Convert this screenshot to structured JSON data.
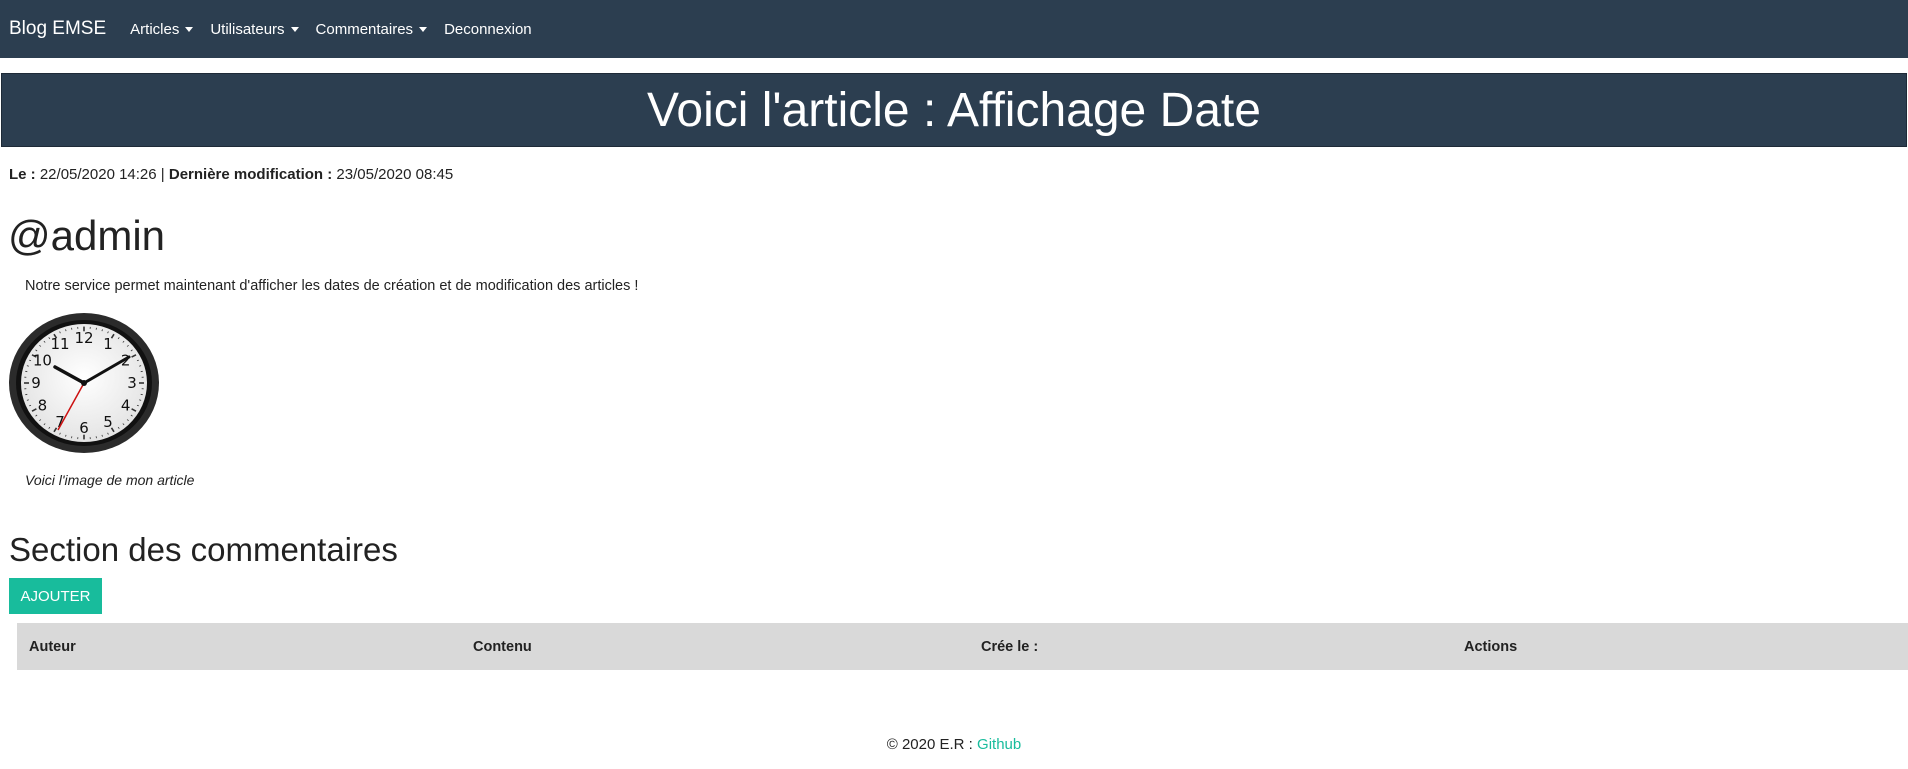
{
  "navbar": {
    "brand": "Blog EMSE",
    "items": [
      {
        "label": "Articles",
        "dropdown": true
      },
      {
        "label": "Utilisateurs",
        "dropdown": true
      },
      {
        "label": "Commentaires",
        "dropdown": true
      },
      {
        "label": "Deconnexion",
        "dropdown": false
      }
    ]
  },
  "article": {
    "title": "Voici l'article : Affichage Date",
    "meta": {
      "created_label": "Le :",
      "created_value": "22/05/2020 14:26",
      "separator": "|",
      "modified_label": "Dernière modification :",
      "modified_value": "23/05/2020 08:45"
    },
    "author": "@admin",
    "content": "Notre service permet maintenant d'afficher les dates de création et de modification des articles !",
    "image_caption": "Voici l'image de mon article",
    "clock_numbers": [
      "12",
      "1",
      "2",
      "3",
      "4",
      "5",
      "6",
      "7",
      "8",
      "9",
      "10",
      "11"
    ]
  },
  "comments": {
    "title": "Section des commentaires",
    "add_button": "AJOUTER",
    "columns": [
      "Auteur",
      "Contenu",
      "Crée le :",
      "Actions"
    ]
  },
  "footer": {
    "copyright": "© 2020 E.R :",
    "link_text": "Github"
  },
  "colors": {
    "navbar_bg": "#2c3e50",
    "accent": "#18bc9c",
    "table_header_bg": "#d9d9d9"
  }
}
